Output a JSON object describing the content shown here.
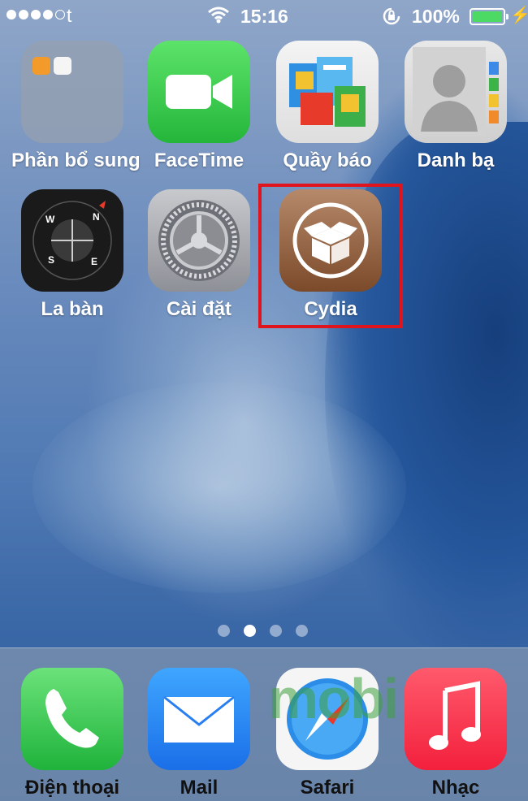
{
  "status_bar": {
    "carrier": "t",
    "time": "15:16",
    "battery_percent": "100%",
    "battery_color": "#4cd964"
  },
  "home": {
    "apps": [
      {
        "name": "Phần bổ sung",
        "icon": "folder-icon"
      },
      {
        "name": "FaceTime",
        "icon": "video-camera-icon"
      },
      {
        "name": "Quầy báo",
        "icon": "newsstand-icon"
      },
      {
        "name": "Danh bạ",
        "icon": "contacts-icon"
      },
      {
        "name": "La bàn",
        "icon": "compass-icon"
      },
      {
        "name": "Cài đặt",
        "icon": "gear-icon"
      },
      {
        "name": "Cydia",
        "icon": "cydia-box-icon"
      }
    ],
    "compass_letters": {
      "n": "N",
      "e": "E",
      "s": "S",
      "w": "W"
    },
    "highlight_color": "#e0141c",
    "page_count": 4,
    "active_page": 2
  },
  "dock": {
    "apps": [
      {
        "name": "Điện thoại",
        "icon": "phone-icon"
      },
      {
        "name": "Mail",
        "icon": "envelope-icon"
      },
      {
        "name": "Safari",
        "icon": "safari-compass-icon"
      },
      {
        "name": "Nhạc",
        "icon": "music-note-icon"
      }
    ]
  },
  "watermark": "mobi"
}
